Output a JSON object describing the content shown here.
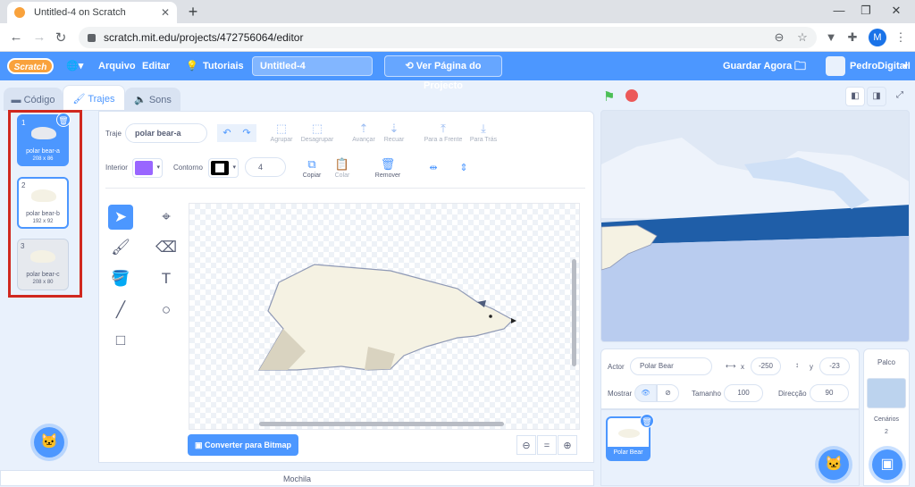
{
  "browser": {
    "tab_title": "Untitled-4 on Scratch",
    "url": "scratch.mit.edu/projects/472756064/editor",
    "profile_initial": "M"
  },
  "menu": {
    "logo": "Scratch",
    "file": "Arquivo",
    "edit": "Editar",
    "tutorials": "Tutoriais",
    "project_title": "Untitled-4",
    "share": "Ver Página do Projecto",
    "save_now": "Guardar Agora",
    "username": "PedroDigitalI"
  },
  "tabs": {
    "code": "Código",
    "costumes": "Trajes",
    "sounds": "Sons"
  },
  "costumes": [
    {
      "number": "1",
      "name": "polar bear-a",
      "size": "208 x 86"
    },
    {
      "number": "2",
      "name": "polar bear-b",
      "size": "192 x 92"
    },
    {
      "number": "3",
      "name": "polar bear-c",
      "size": "208 x 80"
    }
  ],
  "paint": {
    "costume_label": "Traje",
    "costume_name": "polar bear-a",
    "group": "Agrupar",
    "ungroup": "Desagrupar",
    "forward": "Avançar",
    "backward": "Recuar",
    "front": "Para a Frente",
    "back": "Para Trás",
    "fill_label": "Interior",
    "outline_label": "Contorno",
    "outline_width": "4",
    "copy": "Copiar",
    "paste": "Colar",
    "delete": "Remover",
    "convert_bitmap": "Converter para Bitmap",
    "fill_color": "#9966ff",
    "outline_color": "#000000"
  },
  "backpack": "Mochila",
  "sprite": {
    "label": "Actor",
    "name": "Polar Bear",
    "x_label": "x",
    "x": "-250",
    "y_label": "y",
    "y": "-23",
    "show_label": "Mostrar",
    "size_label": "Tamanho",
    "size": "100",
    "direction_label": "Direcção",
    "direction": "90"
  },
  "sprites": [
    {
      "name": "Polar Bear"
    }
  ],
  "stage_panel": {
    "title": "Palco",
    "backdrops_label": "Cenários",
    "backdrops_count": "2"
  },
  "colors": {
    "accent": "#4c97ff",
    "highlight_box": "#d0281f",
    "flag": "#4cbf56",
    "stop": "#ec5959"
  }
}
